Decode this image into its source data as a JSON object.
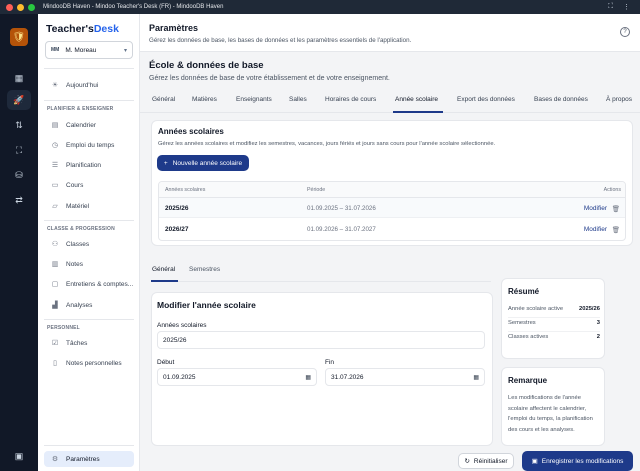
{
  "window": {
    "title": "MindooDB Haven - Mindoo Teacher's Desk (FR) - MindooDB Haven"
  },
  "rail": {
    "icons": [
      "dashboard-icon",
      "rocket-icon",
      "sync-icon",
      "scan-icon",
      "database-icon",
      "sliders-icon",
      "sidebar-toggle-icon"
    ]
  },
  "sidebar": {
    "brand_prefix": "Teacher's",
    "brand_accent": "Desk",
    "user": {
      "initials": "MM",
      "name": "M. Moreau"
    },
    "today": "Aujourd'hui",
    "section_plan": "PLANIFIER & ENSEIGNER",
    "plan_items": [
      "Calendrier",
      "Emploi du temps",
      "Planification",
      "Cours",
      "Matériel"
    ],
    "section_classes": "CLASSE & PROGRESSION",
    "class_items": [
      "Classes",
      "Notes",
      "Entretiens & comptes...",
      "Analyses"
    ],
    "section_personal": "PERSONNEL",
    "personal_items": [
      "Tâches",
      "Notes personnelles"
    ],
    "settings": "Paramètres"
  },
  "header": {
    "title": "Paramètres",
    "subtitle": "Gérez les données de base, les bases de données et les paramètres essentiels de l'application."
  },
  "section": {
    "title": "École & données de base",
    "subtitle": "Gérez les données de base de votre établissement et de votre enseignement."
  },
  "tabs": [
    "Général",
    "Matières",
    "Enseignants",
    "Salles",
    "Horaires de cours",
    "Année scolaire",
    "Export des données",
    "Bases de données",
    "À propos"
  ],
  "active_tab": "Année scolaire",
  "years_card": {
    "title": "Années scolaires",
    "subtitle": "Gérez les années scolaires et modifiez les semestres, vacances, jours fériés et jours sans cours pour l'année scolaire sélectionnée.",
    "new_button": "Nouvelle année scolaire",
    "columns": [
      "Années scolaires",
      "Période",
      "Actions"
    ],
    "rows": [
      {
        "year": "2025/26",
        "period": "01.09.2025 – 31.07.2026",
        "action": "Modifier"
      },
      {
        "year": "2026/27",
        "period": "01.09.2026 – 31.07.2027",
        "action": "Modifier"
      }
    ]
  },
  "subtabs": [
    "Général",
    "Semestres"
  ],
  "form": {
    "title": "Modifier l'année scolaire",
    "year_label": "Années scolaires",
    "year_value": "2025/26",
    "start_label": "Début",
    "start_value": "01.09.2025",
    "end_label": "Fin",
    "end_value": "31.07.2026"
  },
  "summary": {
    "title": "Résumé",
    "rows": [
      {
        "label": "Année scolaire active",
        "value": "2025/26"
      },
      {
        "label": "Semestres",
        "value": "3"
      },
      {
        "label": "Classes actives",
        "value": "2"
      }
    ]
  },
  "note": {
    "title": "Remarque",
    "text": "Les modifications de l'année scolaire affectent le calendrier, l'emploi du temps, la planification des cours et les analyses."
  },
  "actions": {
    "reset": "Réinitialiser",
    "save": "Enregistrer les modifications"
  },
  "colors": {
    "primary": "#1e3a8a",
    "link": "#2563eb",
    "traffic_red": "#ff5f57",
    "traffic_yellow": "#febc2e",
    "traffic_green": "#28c840"
  }
}
